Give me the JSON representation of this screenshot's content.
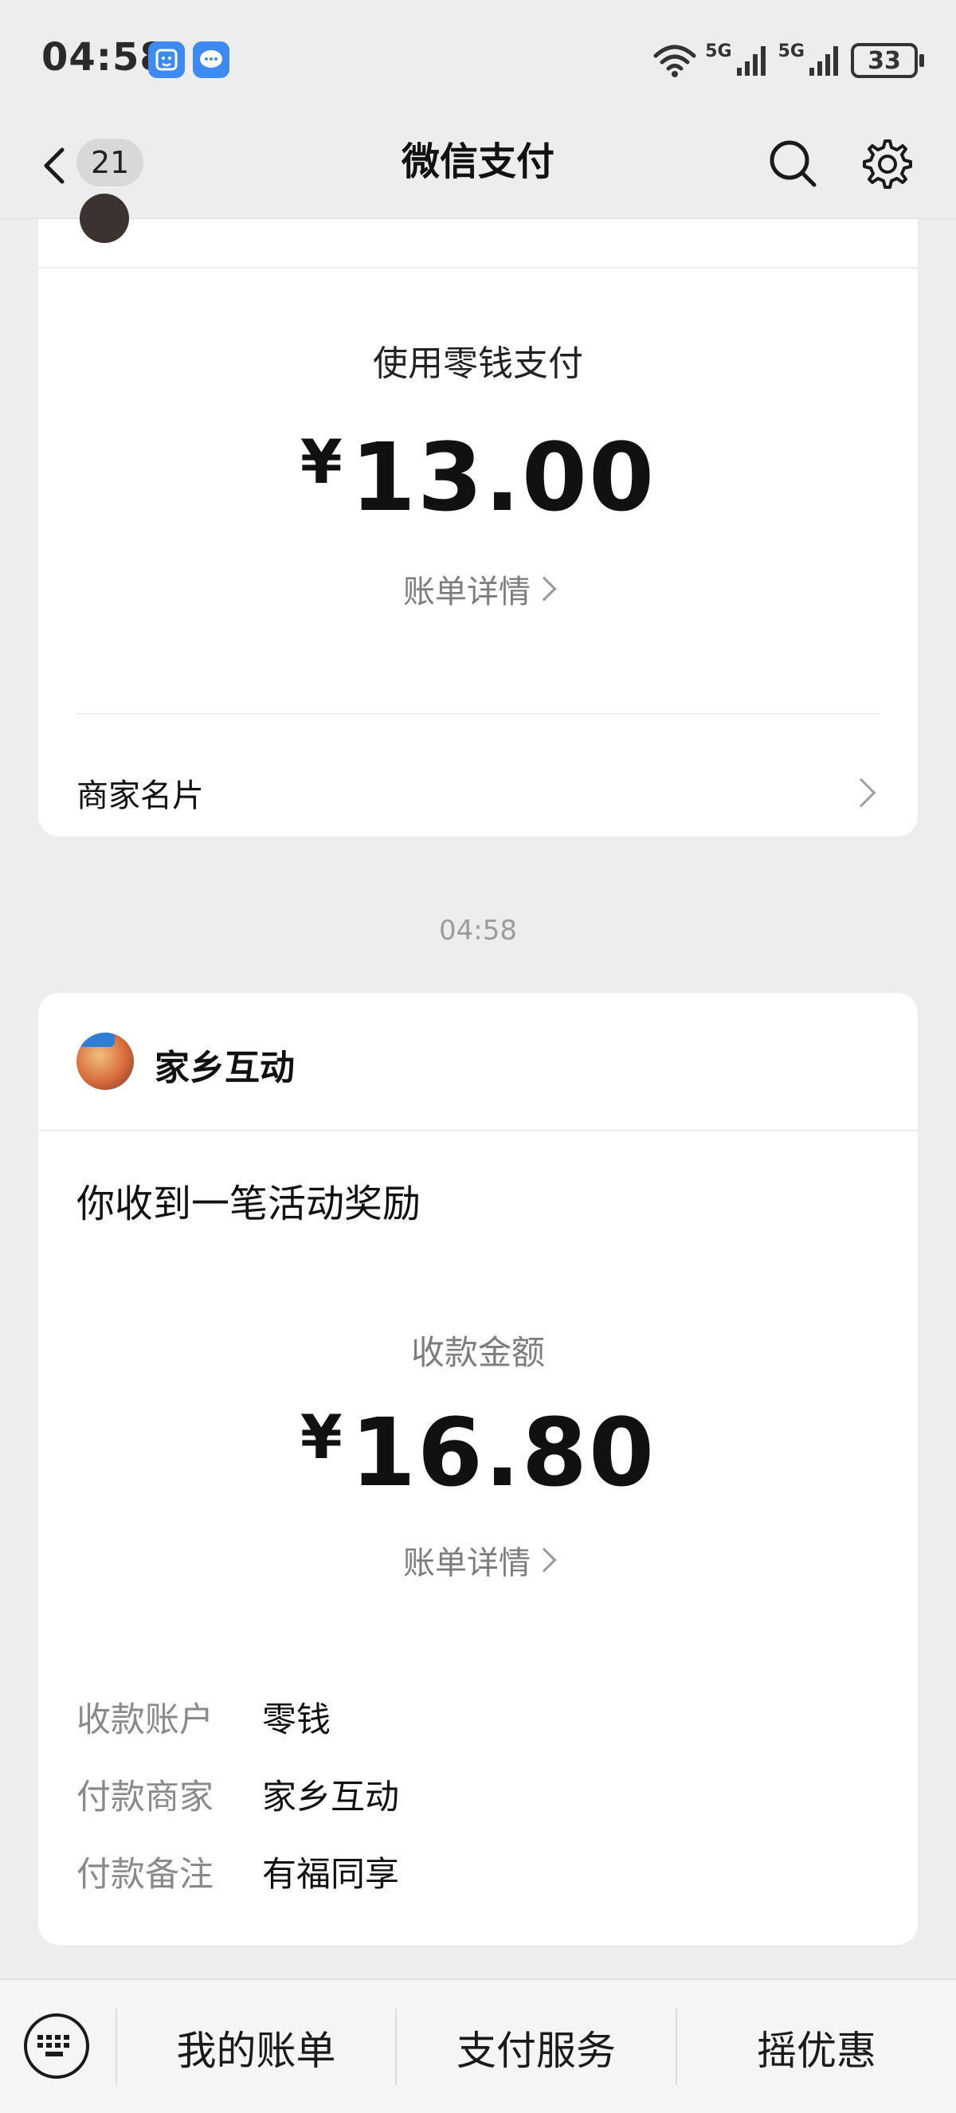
{
  "status_bar": {
    "time": "04:58",
    "network_1": "5G",
    "network_2": "5G",
    "battery": "33",
    "icons": [
      "face-id-app-icon",
      "message-app-icon",
      "wifi-icon",
      "signal-icon",
      "signal-icon",
      "battery-icon"
    ]
  },
  "nav": {
    "unread_count": "21",
    "title": "微信支付",
    "icons": [
      "back-arrow-icon",
      "search-icon",
      "gear-icon"
    ]
  },
  "card1": {
    "pay_method": "使用零钱支付",
    "currency": "¥",
    "amount": "13.00",
    "detail_link": "账单详情",
    "merchant_card": "商家名片"
  },
  "timestamp": "04:58",
  "card2": {
    "merchant": "家乡互动",
    "title": "你收到一笔活动奖励",
    "receive_label": "收款金额",
    "currency": "¥",
    "amount": "16.80",
    "detail_link": "账单详情",
    "rows": [
      {
        "key": "收款账户",
        "value": "零钱"
      },
      {
        "key": "付款商家",
        "value": "家乡互动"
      },
      {
        "key": "付款备注",
        "value": "有福同享"
      }
    ]
  },
  "bottom_bar": {
    "items": [
      "我的账单",
      "支付服务",
      "摇优惠"
    ],
    "keyboard_icon": "keyboard-icon"
  },
  "colors": {
    "background": "#ededed",
    "card": "#ffffff",
    "muted_text": "#7d7d7d"
  }
}
